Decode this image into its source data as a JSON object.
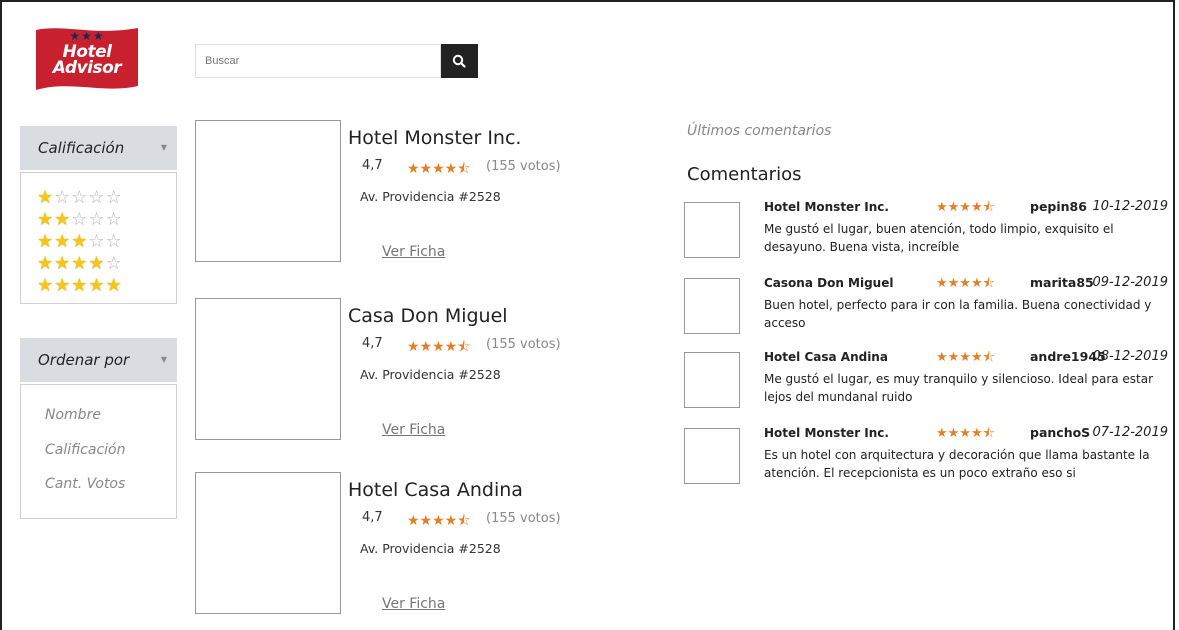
{
  "brand": {
    "line1": "Hotel",
    "line2": "Advisor",
    "flag_color": "#c8202f",
    "star_color": "#1b2a4a"
  },
  "search": {
    "placeholder": "Buscar",
    "button_icon": "search-icon"
  },
  "filters": {
    "rating": {
      "title": "Calificación",
      "options": [
        1,
        2,
        3,
        4,
        5
      ],
      "max_stars": 5
    },
    "sort": {
      "title": "Ordenar por",
      "options": [
        "Nombre",
        "Calificación",
        "Cant. Votos"
      ]
    }
  },
  "hotels": [
    {
      "name": "Hotel Monster Inc.",
      "rating": "4,7",
      "stars": 4.5,
      "votes": "(155 votos)",
      "address": "Av. Providencia #2528",
      "action": "Ver Ficha"
    },
    {
      "name": "Casa Don Miguel",
      "rating": "4,7",
      "stars": 4.5,
      "votes": "(155 votos)",
      "address": "Av. Providencia #2528",
      "action": "Ver Ficha"
    },
    {
      "name": "Hotel Casa Andina",
      "rating": "4,7",
      "stars": 4.5,
      "votes": "(155 votos)",
      "address": "Av. Providencia #2528",
      "action": "Ver Ficha"
    }
  ],
  "comments_section": {
    "subtitle": "Últimos comentarios",
    "title": "Comentarios",
    "items": [
      {
        "hotel": "Hotel Monster Inc.",
        "stars": 4.5,
        "user": "pepin86",
        "date": "10-12-2019",
        "text": "Me gustó el lugar, buen atención, todo limpio, exquisito el desayuno. Buena vista, increíble"
      },
      {
        "hotel": "Casona Don Miguel",
        "stars": 4.5,
        "user": "marita85",
        "date": "09-12-2019",
        "text": "Buen hotel, perfecto para ir con la familia. Buena conectividad y acceso"
      },
      {
        "hotel": "Hotel Casa Andina",
        "stars": 4.5,
        "user": "andre1945",
        "date": "08-12-2019",
        "text": "Me gustó el lugar, es muy tranquilo y silencioso. Ideal para estar lejos del mundanal ruido"
      },
      {
        "hotel": "Hotel Monster Inc.",
        "stars": 4.5,
        "user": "panchoS",
        "date": "07-12-2019",
        "text": "Es un hotel con arquitectura y decoración que llama bastante la atención. El recepcionista es un poco extraño eso si"
      }
    ]
  },
  "colors": {
    "accent_orange": "#e67e22",
    "star_yellow": "#f5c518",
    "panel_header": "#d9dde2"
  }
}
